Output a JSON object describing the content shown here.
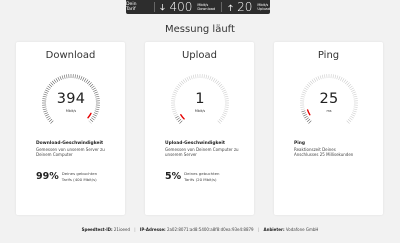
{
  "tarif": {
    "label": "Dein Tarif",
    "download_value": "400",
    "download_unit": "Mbit/s",
    "download_label": "Download",
    "upload_value": "20",
    "upload_unit": "Mbit/s",
    "upload_label": "Upload"
  },
  "title": "Messung läuft",
  "cards": [
    {
      "title": "Download",
      "value": "394",
      "unit": "Mbit/s",
      "fraction": 0.985,
      "desc_title": "Download-Geschwindigkeit",
      "desc_text": "Gemessen von unserem Server zu Deinem Computer",
      "pct": "99%",
      "pct_text": "Deines gebuchten Tarifs (400 Mbit/s)"
    },
    {
      "title": "Upload",
      "value": "1",
      "unit": "Mbit/s",
      "fraction": 0.05,
      "desc_title": "Upload-Geschwindigkeit",
      "desc_text": "Gemessen von Deinem Computer zu unserem Server",
      "pct": "5%",
      "pct_text": "Deines gebuchten Tarifs (20 Mbit/s)"
    },
    {
      "title": "Ping",
      "value": "25",
      "unit": "ms",
      "fraction": 0.1,
      "desc_title": "Ping",
      "desc_text": "Reaktionszeit Deines Anschlusses 25 Millisekunden",
      "pct": "",
      "pct_text": ""
    }
  ],
  "footer": {
    "speedtest_label": "Speedtest-ID:",
    "speedtest_id": "21ioeed",
    "ip_label": "IP-Adresse:",
    "ip_value": "2a02:8071:ad8:5400:a8f8:d0ea:93e4:8879",
    "provider_label": "Anbieter:",
    "provider_value": "Vodafone GmbH"
  },
  "colors": {
    "accent": "#e60000",
    "tick": "#c8c8c8",
    "background": "#f2f2f2"
  },
  "icons": {
    "download": "download-arrow-icon",
    "upload": "upload-arrow-icon"
  }
}
